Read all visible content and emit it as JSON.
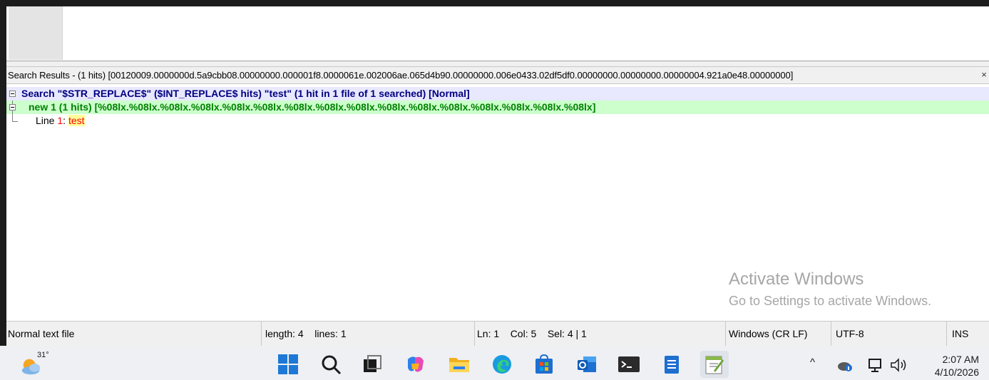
{
  "search_panel": {
    "title": "Search Results - (1 hits) [00120009.0000000d.5a9cbb08.00000000.000001f8.0000061e.002006ae.065d4b90.00000000.006e0433.02df5df0.00000000.00000000.00000004.921a0e48.00000000]",
    "close_glyph": "×",
    "search_row": "Search \"$STR_REPLACE$\" ($INT_REPLACE$ hits) \"test\" (1 hit in 1 file of 1 searched) [Normal]",
    "file_row": "new 1 (1 hits) [%08lx.%08lx.%08lx.%08lx.%08lx.%08lx.%08lx.%08lx.%08lx.%08lx.%08lx.%08lx.%08lx.%08lx.%08lx.%08lx]",
    "line_label": "Line",
    "line_number": "1",
    "line_sep": ":",
    "line_hit": "test"
  },
  "watermark": {
    "title": "Activate Windows",
    "subtitle": "Go to Settings to activate Windows."
  },
  "statusbar": {
    "file_type": "Normal text file",
    "length_lines": "length: 4    lines: 1",
    "position": "Ln: 1    Col: 5    Sel: 4 | 1",
    "eol": "Windows (CR LF)",
    "encoding": "UTF-8",
    "mode": "INS"
  },
  "taskbar": {
    "weather_temp": "31°",
    "icons": [
      "start-icon",
      "search-icon",
      "task-view-icon",
      "copilot-icon",
      "file-explorer-icon",
      "edge-icon",
      "store-icon",
      "outlook-icon",
      "terminal-icon",
      "notepad-icon",
      "notepad-plus-plus-icon"
    ],
    "time": "2:07 AM",
    "date": "4/10/2026",
    "tray_chevron": "^"
  }
}
